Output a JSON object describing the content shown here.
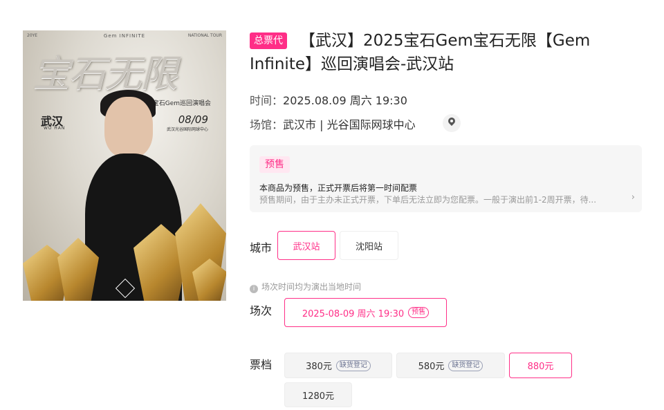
{
  "poster": {
    "top_left": "20YE",
    "top_center": "Gem INFINITE",
    "top_right": "NATIONAL TOUR",
    "big_title": "宝石无限",
    "subtitle": "宝石Gem巡回演唱会",
    "city": "武汉",
    "city_en": "WU HAN",
    "date": "08/09",
    "venue": "武汉光谷国际网球中心"
  },
  "header": {
    "tag": "总票代",
    "title": "【武汉】2025宝石Gem宝石无限【Gem Infinite】巡回演唱会-武汉站"
  },
  "info": {
    "time_label": "时间：",
    "time_value": "2025.08.09 周六 19:30",
    "venue_label": "场馆：",
    "venue_value": "武汉市 | 光谷国际网球中心"
  },
  "presale": {
    "tag": "预售",
    "line1": "本商品为预售，正式开票后将第一时间配票",
    "line2": "预售期间，由于主办未正式开票，下单后无法立即为您配票。一般于演出前1-2周开票，待...",
    "arrow": "›"
  },
  "city_section": {
    "label": "城市",
    "options": [
      "武汉站",
      "沈阳站"
    ]
  },
  "session_section": {
    "note": "场次时间均为演出当地时间",
    "label": "场次",
    "option": "2025-08-09 周六 19:30",
    "option_badge": "预售"
  },
  "price_section": {
    "label": "票档",
    "options": [
      {
        "price": "380元",
        "badge": "缺货登记"
      },
      {
        "price": "580元",
        "badge": "缺货登记"
      },
      {
        "price": "880元",
        "badge": ""
      },
      {
        "price": "1280元",
        "badge": ""
      }
    ]
  },
  "colors": {
    "accent": "#ff2e87",
    "presale_bg": "#f6f6f6"
  }
}
